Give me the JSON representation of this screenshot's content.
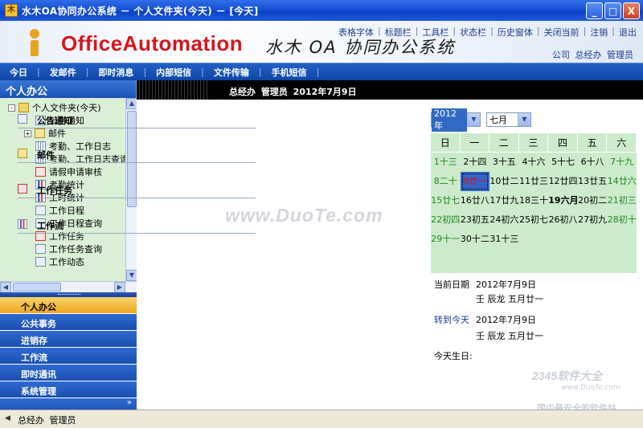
{
  "window": {
    "title": "水木OA协同办公系统 － 个人文件夹(今天) － [今天]",
    "controls": [
      "_",
      "□",
      "X"
    ]
  },
  "header": {
    "brand": "OfficeAutomation",
    "brand_cn": "水木 OA 协同办公系统",
    "top_menu": [
      "表格字体",
      "标题栏",
      "工具栏",
      "状态栏",
      "历史窗体",
      "关闭当前",
      "注销",
      "退出"
    ],
    "user_line": "公司 总经办 管理员"
  },
  "nav": {
    "items": [
      "今日",
      "发邮件",
      "即时消息",
      "内部短信",
      "文件传输",
      "手机短信"
    ]
  },
  "sidebar": {
    "title": "个人办公",
    "tree": [
      {
        "label": "个人文件夹(今天)",
        "icon": "folder",
        "level": 0,
        "expander": "-"
      },
      {
        "label": "公告通知",
        "icon": "doc",
        "level": 1
      },
      {
        "label": "邮件",
        "icon": "mail",
        "level": 1,
        "expander": "+"
      },
      {
        "label": "考勤、工作日志",
        "icon": "grid",
        "level": 1
      },
      {
        "label": "考勤、工作日志查询",
        "icon": "grid",
        "level": 1
      },
      {
        "label": "请假申请审核",
        "icon": "red",
        "level": 1
      },
      {
        "label": "考勤统计",
        "icon": "chart",
        "level": 1
      },
      {
        "label": "工时统计",
        "icon": "chart",
        "level": 1
      },
      {
        "label": "工作日程",
        "icon": "doc",
        "level": 1
      },
      {
        "label": "工作日程查询",
        "icon": "doc",
        "level": 1
      },
      {
        "label": "工作任务",
        "icon": "red",
        "level": 1
      },
      {
        "label": "工作任务查询",
        "icon": "doc",
        "level": 1
      },
      {
        "label": "工作动态",
        "icon": "doc",
        "level": 1
      }
    ],
    "modules": [
      {
        "label": "个人办公",
        "active": true
      },
      {
        "label": "公共事务",
        "active": false
      },
      {
        "label": "进销存",
        "active": false
      },
      {
        "label": "工作流",
        "active": false
      },
      {
        "label": "即时通讯",
        "active": false
      },
      {
        "label": "系统管理",
        "active": false
      }
    ],
    "more_glyph": "»"
  },
  "content": {
    "header_caption": "总经办 管理员 2012年7月9日",
    "sections": [
      {
        "label": "公告通知",
        "icon": "notice-icon"
      },
      {
        "label": "邮件",
        "icon": "mail-icon"
      },
      {
        "label": "工作任务",
        "icon": "task-icon"
      },
      {
        "label": "工作流",
        "icon": "workflow-icon"
      }
    ],
    "watermark": "www.DuoTe.com"
  },
  "calendar": {
    "year_select": "2012年",
    "month_select": "七月",
    "weekdays": [
      "日",
      "一",
      "二",
      "三",
      "四",
      "五",
      "六"
    ],
    "weeks": [
      [
        "1十三",
        "2十四",
        "3十五",
        "4十六",
        "5十七",
        "6十八",
        "7十九"
      ],
      [
        "8二十",
        "9廿一",
        "10廿二",
        "11廿三",
        "12廿四",
        "13廿五",
        "14廿六"
      ],
      [
        "15廿七",
        "16廿八",
        "17廿九",
        "18三十",
        "19六月",
        "20初二",
        "21初三"
      ],
      [
        "22初四",
        "23初五",
        "24初六",
        "25初七",
        "26初八",
        "27初九",
        "28初十"
      ],
      [
        "29十一",
        "30十二",
        "31十三",
        "",
        "",
        "",
        ""
      ]
    ],
    "today_cell": "9廿一",
    "bold_cell": "19六月",
    "current_date_label": "当前日期",
    "current_date": "2012年7月9日",
    "current_lunar": "壬 辰龙 五月廿一",
    "goto_today_label": "转到今天",
    "goto_date": "2012年7月9日",
    "goto_lunar": "壬 辰龙 五月廿一",
    "birthday_label": "今天生日:"
  },
  "brandmark": {
    "top": "2345软件大全",
    "url": "www.DuoTe.com",
    "sub": "国内最安全的软件站"
  },
  "status": {
    "text": "总经办 管理员"
  },
  "colors": {
    "title_bar": "#1650d6",
    "brand_red": "#d8151b",
    "nav_blue": "#0e45a8",
    "calendar_bg": "#ccebcb",
    "weekend_green": "#1c8a1c",
    "active_module": "#f0a51c"
  }
}
